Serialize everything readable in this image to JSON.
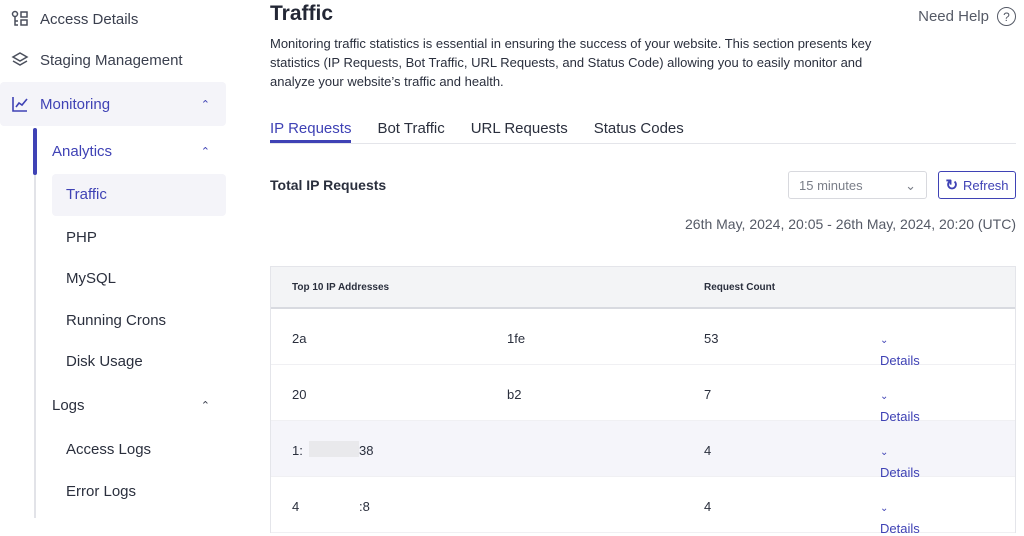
{
  "sidebar": {
    "items": [
      {
        "label": "Access Details"
      },
      {
        "label": "Staging Management"
      },
      {
        "label": "Monitoring"
      }
    ],
    "analytics": "Analytics",
    "analytics_items": [
      "Traffic",
      "PHP",
      "MySQL",
      "Running Crons",
      "Disk Usage"
    ],
    "logs": "Logs",
    "logs_items": [
      "Access Logs",
      "Error Logs"
    ]
  },
  "accent": "#3f42b5",
  "page": {
    "title": "Traffic",
    "help": "Need Help",
    "help_icon": "?",
    "description": "Monitoring traffic statistics is essential in ensuring the success of your website. This section presents key statistics (IP Requests, Bot Traffic, URL Requests, and Status Code) allowing you to easily monitor and analyze your website’s traffic and health.",
    "tabs": [
      "IP Requests",
      "Bot Traffic",
      "URL Requests",
      "Status Codes"
    ],
    "section_title": "Total IP Requests",
    "interval": "15 minutes",
    "refresh": "Refresh",
    "range": "26th May, 2024, 20:05 - 26th May, 2024, 20:20 (UTC)"
  },
  "table": {
    "headers": [
      "Top 10 IP Addresses",
      "Request Count"
    ],
    "rows": [
      {
        "ip_a": "2a",
        "ip_b": "1fe",
        "count": "53",
        "action": "Details"
      },
      {
        "ip_a": "20",
        "ip_b": "b2",
        "count": "7",
        "action": "Details"
      },
      {
        "ip_a": "1:",
        "ip_b": "38",
        "count": "4",
        "action": "Details"
      },
      {
        "ip_a": "4",
        "ip_b": ":8",
        "count": "4",
        "action": "Details"
      }
    ]
  }
}
